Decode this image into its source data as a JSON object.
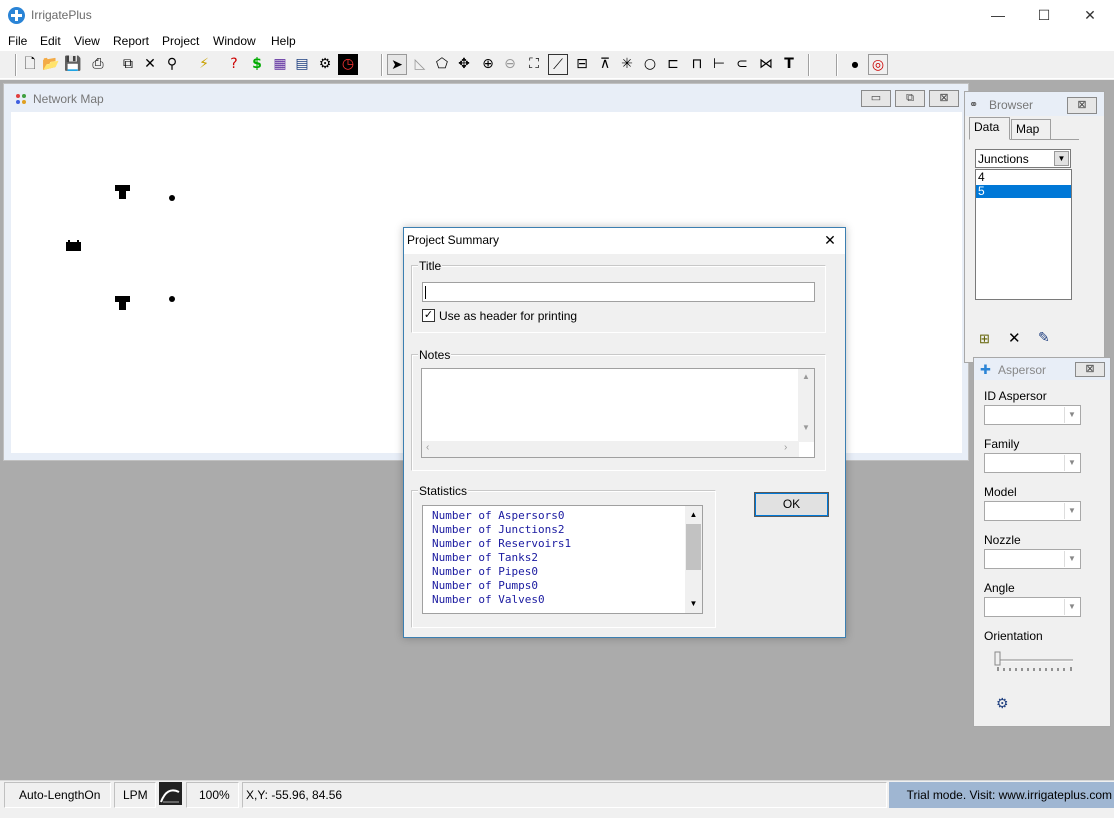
{
  "window": {
    "title": "IrrigatePlus",
    "minimize": "—",
    "maximize": "☐",
    "close": "✕"
  },
  "menu": [
    "File",
    "Edit",
    "View",
    "Report",
    "Project",
    "Window",
    "Help"
  ],
  "network_map": {
    "title": "Network Map",
    "minimize": "▭",
    "restore": "⧉",
    "close": "⊠"
  },
  "browser": {
    "title": "Browser",
    "tabs": [
      "Data",
      "Map"
    ],
    "selected_category": "Junctions",
    "items": [
      "4",
      "5"
    ],
    "selected_item": "5",
    "close": "⊠"
  },
  "aspersor": {
    "title": "Aspersor",
    "close": "⊠",
    "fields": [
      "ID Aspersor",
      "Family",
      "Model",
      "Nozzle",
      "Angle"
    ],
    "orientation_label": "Orientation"
  },
  "dialog": {
    "title": "Project Summary",
    "close": "✕",
    "title_group": "Title",
    "title_value": "",
    "checkbox_label": "Use as header for printing",
    "checkbox_checked": true,
    "notes_group": "Notes",
    "notes_value": "",
    "stats_group": "Statistics",
    "stats": [
      "Number of Aspersors0",
      "Number of Junctions2",
      "Number of Reservoirs1",
      "Number of Tanks2",
      "Number of Pipes0",
      "Number of Pumps0",
      "Number of Valves0"
    ],
    "ok": "OK"
  },
  "status": {
    "auto_length": "Auto-LengthOn",
    "units": "LPM",
    "zoom": "100%",
    "xy": "X,Y: -55.96, 84.56",
    "trial": "Trial mode. Visit: www.irrigateplus.com"
  },
  "colors": {
    "selection": "#0078d7",
    "stats_text": "#1a1aa0",
    "trial_bg": "#9fb6d2"
  }
}
